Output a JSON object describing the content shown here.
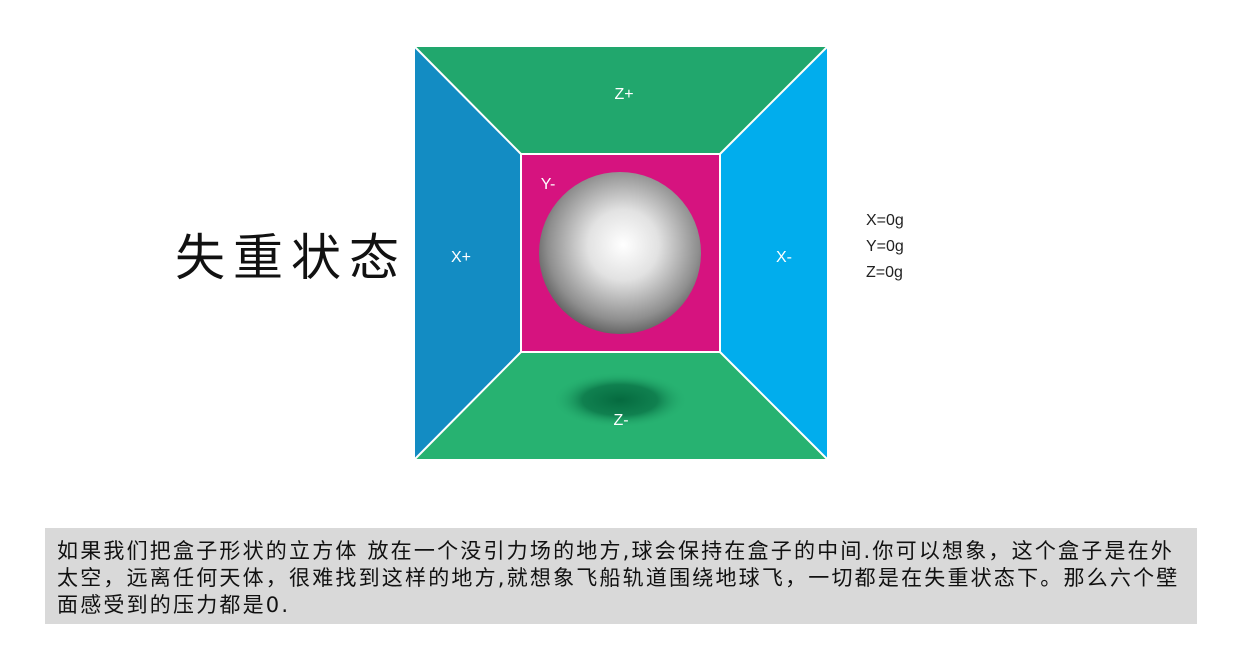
{
  "title": "失重状态",
  "faces": {
    "top": "Z+",
    "bottom": "Z-",
    "left": "X+",
    "right": "X-",
    "back": "Y-"
  },
  "readouts": [
    "X=0g",
    "Y=0g",
    "Z=0g"
  ],
  "caption": "如果我们把盒子形状的立方体 放在一个没引力场的地方,球会保持在盒子的中间.你可以想象，这个盒子是在外太空，远离任何天体，很难找到这样的地方,就想象飞船轨道围绕地球飞，一切都是在失重状态下。那么六个壁面感受到的压力都是0.",
  "colors": {
    "top": "#21a76d",
    "bottom": "#27b271",
    "left": "#138cc3",
    "right": "#01aded",
    "back": "#d6137f",
    "shadow": "#056a3f",
    "caption_bg": "#d9d9d9"
  }
}
